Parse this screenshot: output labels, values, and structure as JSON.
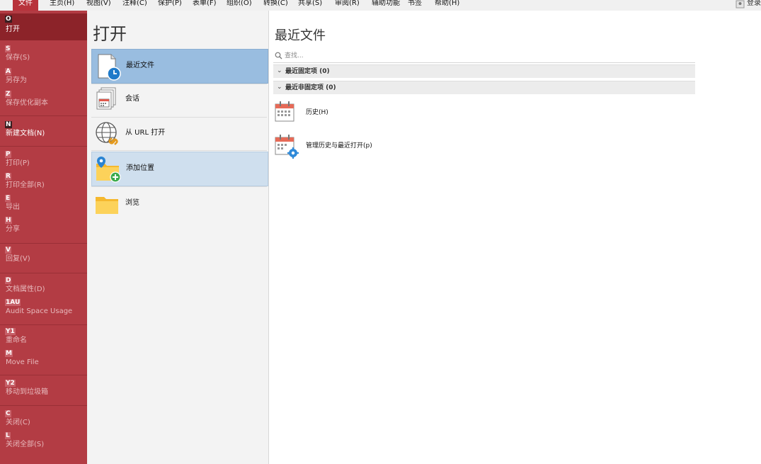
{
  "menubar": {
    "items": [
      "文件",
      "主页(H)",
      "视图(V)",
      "注释(C)",
      "保护(P)",
      "表单(F)",
      "组织(O)",
      "转换(C)",
      "共享(S)",
      "审阅(R)",
      "辅助功能",
      "书签",
      "帮助(H)"
    ],
    "user_label": "登录"
  },
  "backstage": {
    "items": [
      {
        "key": "O",
        "label": "打开"
      },
      {
        "key": "S",
        "label": "保存(S)"
      },
      {
        "key": "A",
        "label": "另存为"
      },
      {
        "key": "Z",
        "label": "保存优化副本"
      },
      {
        "key": "N",
        "label": "新建文档(N)"
      },
      {
        "key": "P",
        "label": "打印(P)"
      },
      {
        "key": "R",
        "label": "打印全部(R)"
      },
      {
        "key": "E",
        "label": "导出"
      },
      {
        "key": "H",
        "label": "分享"
      },
      {
        "key": "V",
        "label": "回复(V)"
      },
      {
        "key": "D",
        "label": "文档属性(D)"
      },
      {
        "key": "1AU",
        "label": "Audit Space Usage"
      },
      {
        "key": "Y1",
        "label": "重命名"
      },
      {
        "key": "M",
        "label": "Move File"
      },
      {
        "key": "Y2",
        "label": "移动到垃圾箱"
      },
      {
        "key": "C",
        "label": "关闭(C)"
      },
      {
        "key": "L",
        "label": "关闭全部(S)"
      }
    ]
  },
  "open_panel": {
    "title": "打开",
    "options": [
      {
        "label": "最近文件",
        "icon": "recent-files-icon"
      },
      {
        "label": "会话",
        "icon": "sessions-icon"
      },
      {
        "label": "从 URL 打开",
        "icon": "globe-link-icon"
      },
      {
        "label": "添加位置",
        "icon": "add-location-icon"
      },
      {
        "label": "浏览",
        "icon": "folder-icon"
      }
    ]
  },
  "recent": {
    "title": "最近文件",
    "search_placeholder": "查找...",
    "groups": [
      {
        "label": "最近固定项 (0)"
      },
      {
        "label": "最近非固定项 (0)"
      }
    ],
    "items": [
      {
        "label": "历史(H)",
        "icon": "calendar-icon"
      },
      {
        "label": "管理历史与最近打开(p)",
        "icon": "calendar-settings-icon"
      }
    ]
  },
  "colors": {
    "accent": "#b33c44",
    "selected": "#8c2329",
    "option_selected": "#99bde0"
  }
}
